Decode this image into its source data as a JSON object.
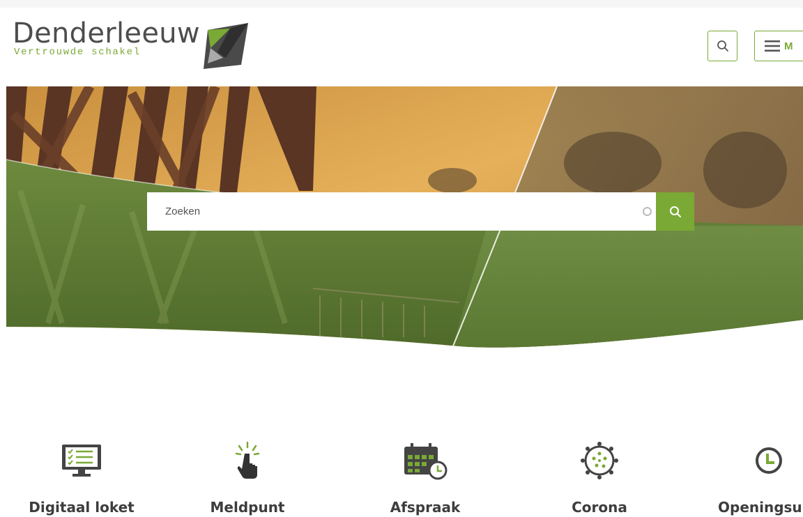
{
  "header": {
    "logo_title": "Denderleeuw",
    "logo_tagline": "Vertrouwde schakel",
    "menu_label": "M"
  },
  "hero": {
    "search": {
      "placeholder": "Zoeken",
      "value": ""
    }
  },
  "quick_links": [
    {
      "label": "Digitaal loket",
      "icon": "computer-checklist-icon"
    },
    {
      "label": "Meldpunt",
      "icon": "hand-pointer-icon"
    },
    {
      "label": "Afspraak",
      "icon": "calendar-clock-icon"
    },
    {
      "label": "Corona",
      "icon": "virus-icon"
    },
    {
      "label": "Openingsu",
      "icon": "clock-icon"
    }
  ],
  "colors": {
    "accent": "#7aa935",
    "text": "#3d3d3d",
    "logo_text": "#4d4d4d"
  }
}
